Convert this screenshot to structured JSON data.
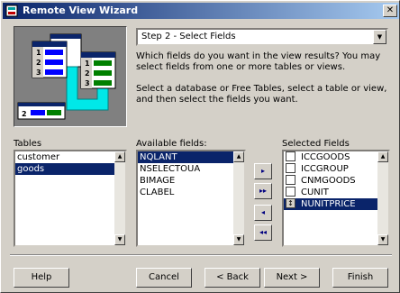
{
  "window": {
    "title": "Remote View Wizard",
    "close_label": "✕"
  },
  "step": {
    "selected": "Step 2 - Select Fields"
  },
  "info": {
    "para1": "Which fields do you want in the view results? You may select fields from one or more tables or views.",
    "para2": "Select a database or Free Tables, select a table or view, and then select the fields you want."
  },
  "tables": {
    "label": "Tables",
    "items": [
      "customer",
      "goods"
    ]
  },
  "available": {
    "label": "Available fields:",
    "items": [
      "NQLANT",
      "NSELECTOUA",
      "BIMAGE",
      "CLABEL"
    ]
  },
  "selected": {
    "label": "Selected Fields",
    "items": [
      "ICCGOODS",
      "ICCGROUP",
      "CNMGOODS",
      "CUNIT",
      "NUNITPRICE"
    ]
  },
  "movers": {
    "add": "▸",
    "add_all": "▸▸",
    "remove": "◂",
    "remove_all": "◂◂"
  },
  "buttons": {
    "help": "Help",
    "cancel": "Cancel",
    "back": "< Back",
    "next": "Next >",
    "finish": "Finish"
  },
  "illustration": {
    "rows": [
      "1",
      "2",
      "3"
    ],
    "bottom": "2"
  },
  "colors": {
    "titlebar": "#0a246a",
    "accent_cyan": "#00e8e8",
    "selection": "#0a246a"
  }
}
